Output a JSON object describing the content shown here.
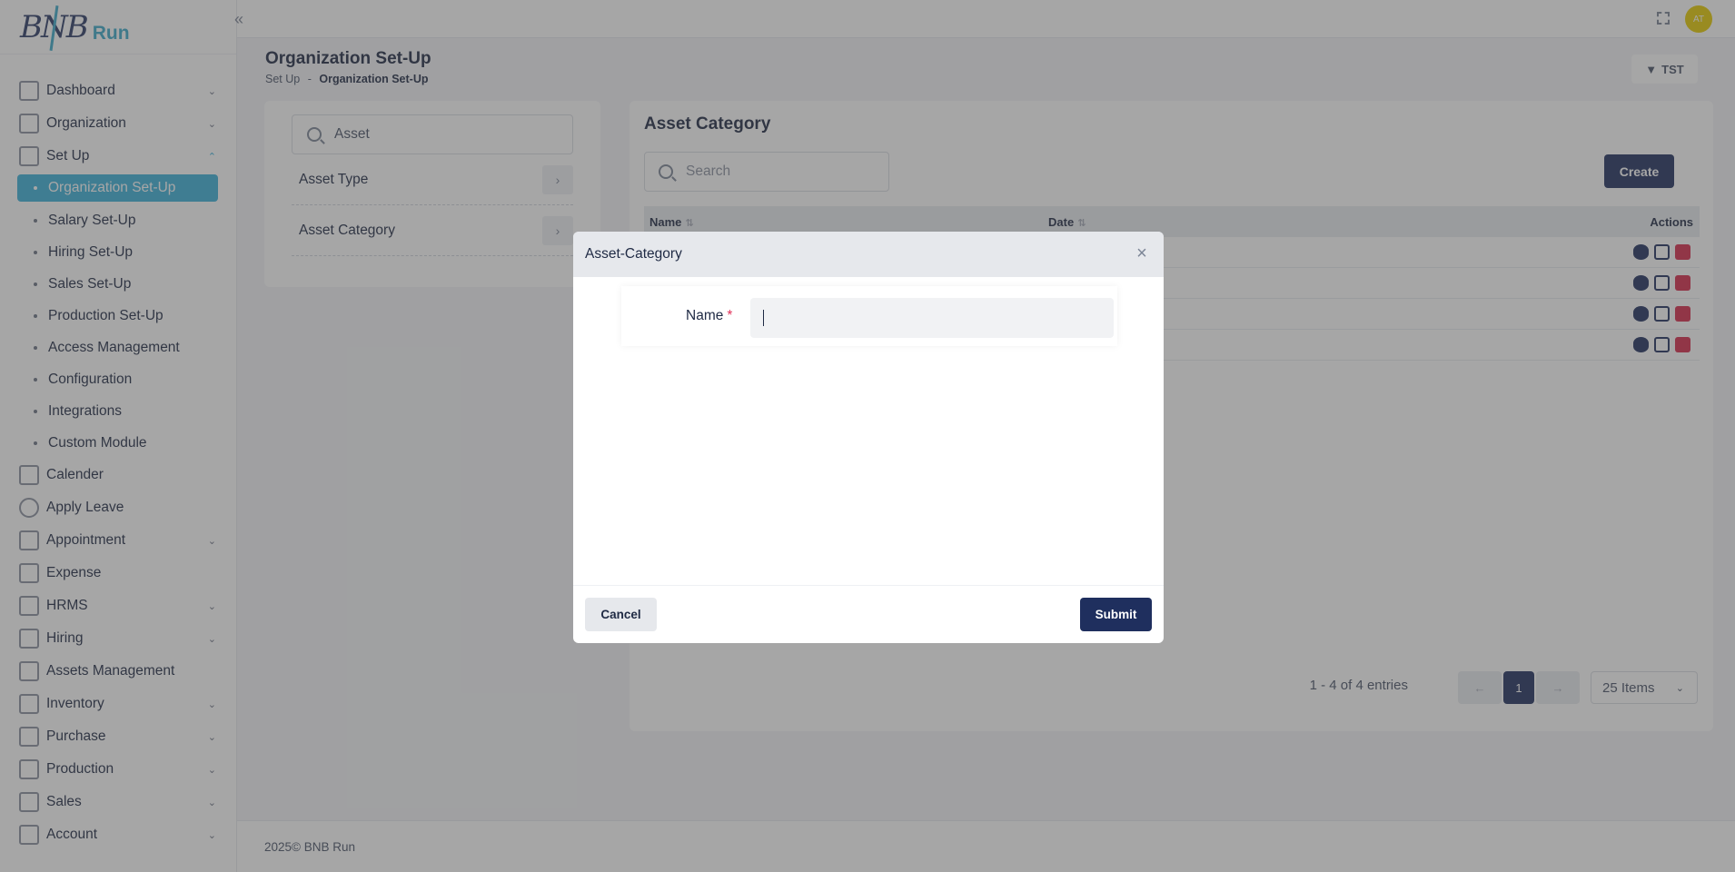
{
  "brand": {
    "logo_letters": "BNB",
    "name": "Run"
  },
  "sidebar": {
    "items": [
      {
        "label": "Dashboard",
        "chevron": "down"
      },
      {
        "label": "Organization",
        "chevron": "down"
      },
      {
        "label": "Set Up",
        "chevron": "up"
      }
    ],
    "setup_sub": [
      {
        "label": "Organization Set-Up",
        "active": true
      },
      {
        "label": "Salary Set-Up"
      },
      {
        "label": "Hiring Set-Up"
      },
      {
        "label": "Sales Set-Up"
      },
      {
        "label": "Production Set-Up"
      },
      {
        "label": "Access Management"
      },
      {
        "label": "Configuration"
      },
      {
        "label": "Integrations"
      },
      {
        "label": "Custom Module"
      }
    ],
    "items_after": [
      {
        "label": "Calender",
        "chevron": ""
      },
      {
        "label": "Apply Leave",
        "chevron": ""
      },
      {
        "label": "Appointment",
        "chevron": "down"
      },
      {
        "label": "Expense",
        "chevron": ""
      },
      {
        "label": "HRMS",
        "chevron": "down"
      },
      {
        "label": "Hiring",
        "chevron": "down"
      },
      {
        "label": "Assets Management",
        "chevron": ""
      },
      {
        "label": "Inventory",
        "chevron": "down"
      },
      {
        "label": "Purchase",
        "chevron": "down"
      },
      {
        "label": "Production",
        "chevron": "down"
      },
      {
        "label": "Sales",
        "chevron": "down"
      },
      {
        "label": "Account",
        "chevron": "down"
      }
    ]
  },
  "topbar": {
    "avatar_initials": "AT"
  },
  "page": {
    "title": "Organization Set-Up",
    "breadcrumb_root": "Set Up",
    "breadcrumb_sep": "-",
    "breadcrumb_current": "Organization Set-Up",
    "filter_label": "TST"
  },
  "left_panel": {
    "search_value": "Asset",
    "rows": [
      "Asset Type",
      "Asset Category"
    ]
  },
  "right_panel": {
    "title": "Asset Category",
    "search_placeholder": "Search",
    "create_label": "Create",
    "columns": {
      "name": "Name",
      "date": "Date",
      "actions": "Actions"
    },
    "row_count": 4,
    "entries_text": "1 - 4 of 4 entries",
    "pagination": {
      "prev": "←",
      "current": "1",
      "next": "→"
    },
    "page_size": "25 Items"
  },
  "footer": {
    "text": "2025© BNB Run"
  },
  "modal": {
    "title": "Asset-Category",
    "name_label": "Name",
    "required_mark": "*",
    "name_value": "",
    "cancel_label": "Cancel",
    "submit_label": "Submit"
  },
  "colors": {
    "primary": "#1f2f5e",
    "accent": "#3ab0d8",
    "danger": "#d6294a",
    "avatar": "#e6cc00"
  }
}
